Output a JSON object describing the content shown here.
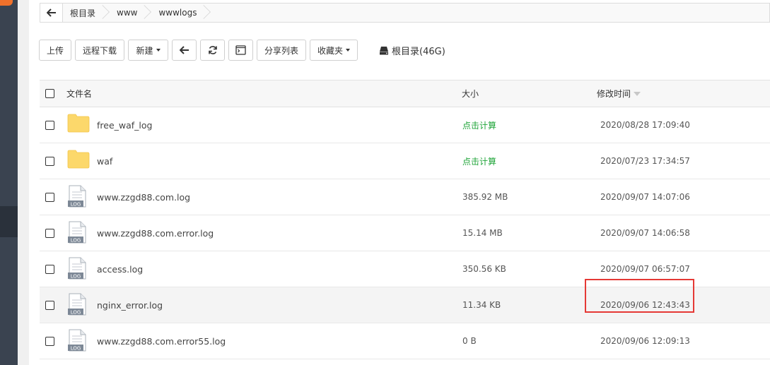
{
  "breadcrumb": {
    "items": [
      "根目录",
      "www",
      "wwwlogs"
    ]
  },
  "toolbar": {
    "upload_label": "上传",
    "remote_download_label": "远程下载",
    "new_label": "新建",
    "share_list_label": "分享列表",
    "favorites_label": "收藏夹",
    "disk_info": "根目录(46G)"
  },
  "table": {
    "headers": {
      "name": "文件名",
      "size": "大小",
      "modified": "修改时间"
    },
    "rows": [
      {
        "type": "folder",
        "name": "free_waf_log",
        "size": "点击计算",
        "modified": "2020/08/28 17:09:40"
      },
      {
        "type": "folder",
        "name": "waf",
        "size": "点击计算",
        "modified": "2020/07/23 17:34:57"
      },
      {
        "type": "log",
        "name": "www.zzgd88.com.log",
        "size": "385.92 MB",
        "modified": "2020/09/07 14:07:06"
      },
      {
        "type": "log",
        "name": "www.zzgd88.com.error.log",
        "size": "15.14 MB",
        "modified": "2020/09/07 14:06:58"
      },
      {
        "type": "log",
        "name": "access.log",
        "size": "350.56 KB",
        "modified": "2020/09/07 06:57:07"
      },
      {
        "type": "log",
        "name": "nginx_error.log",
        "size": "11.34 KB",
        "modified": "2020/09/06 12:43:43"
      },
      {
        "type": "log",
        "name": "www.zzgd88.com.error55.log",
        "size": "0 B",
        "modified": "2020/09/06 12:09:13"
      }
    ]
  },
  "log_icon_label": "LOG",
  "colors": {
    "calc_green": "#20a53a",
    "folder_yellow": "#fcd86b",
    "highlight_red": "#e53935",
    "sidebar_dark": "#3a4350"
  }
}
